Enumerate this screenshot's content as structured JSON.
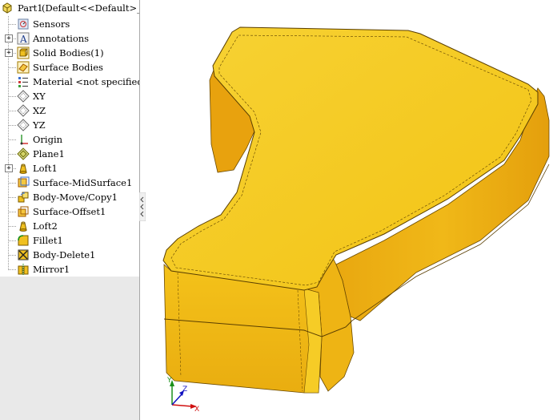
{
  "tree": {
    "part_name": "Part1",
    "config": "(Default<<Default>_Displ",
    "items": [
      {
        "label": "Sensors",
        "icon": "sensors-icon",
        "expandable": false
      },
      {
        "label": "Annotations",
        "icon": "annotations-icon",
        "expandable": true
      },
      {
        "label": "Solid Bodies(1)",
        "icon": "solid-bodies-icon",
        "expandable": true
      },
      {
        "label": "Surface Bodies",
        "icon": "surface-bodies-icon",
        "expandable": false
      },
      {
        "label": "Material <not specified>",
        "icon": "material-icon",
        "expandable": false
      },
      {
        "label": "XY",
        "icon": "plane-icon",
        "expandable": false
      },
      {
        "label": "XZ",
        "icon": "plane-icon",
        "expandable": false
      },
      {
        "label": "YZ",
        "icon": "plane-icon",
        "expandable": false
      },
      {
        "label": "Origin",
        "icon": "origin-icon",
        "expandable": false
      },
      {
        "label": "Plane1",
        "icon": "plane1-icon",
        "expandable": false
      },
      {
        "label": "Loft1",
        "icon": "loft-icon",
        "expandable": true
      },
      {
        "label": "Surface-MidSurface1",
        "icon": "midsurface-icon",
        "expandable": false
      },
      {
        "label": "Body-Move/Copy1",
        "icon": "move-copy-icon",
        "expandable": false
      },
      {
        "label": "Surface-Offset1",
        "icon": "offset-icon",
        "expandable": false
      },
      {
        "label": "Loft2",
        "icon": "loft-icon",
        "expandable": false
      },
      {
        "label": "Fillet1",
        "icon": "fillet-icon",
        "expandable": false
      },
      {
        "label": "Body-Delete1",
        "icon": "body-delete-icon",
        "expandable": false
      },
      {
        "label": "Mirror1",
        "icon": "mirror-icon",
        "expandable": false
      }
    ]
  },
  "triad": {
    "x": "X",
    "y": "Y",
    "z": "Z"
  },
  "colors": {
    "model_face": "#f5c518",
    "model_side": "#eaaa12",
    "model_dark": "#d8900a",
    "panel_bg": "#e9e9e9"
  }
}
